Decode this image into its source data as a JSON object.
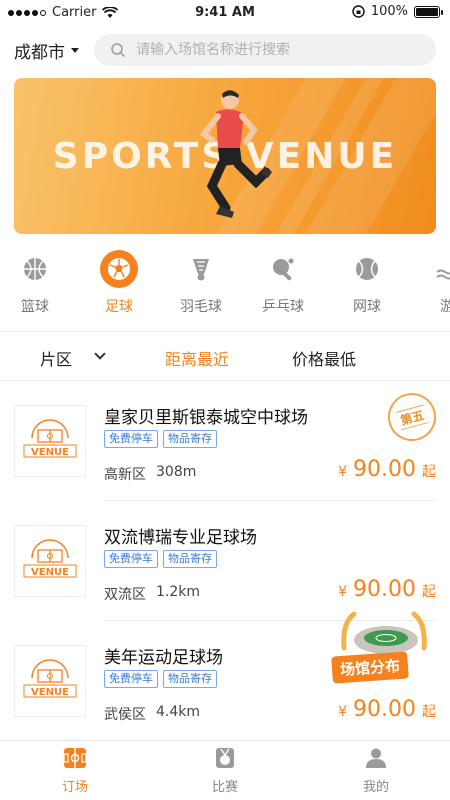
{
  "status_bar": {
    "carrier": "Carrier",
    "time": "9:41 AM",
    "battery": "100%"
  },
  "header": {
    "city": "成都市",
    "search_placeholder": "请输入场馆名称进行搜索"
  },
  "banner": {
    "title": "SPORTS VENUE"
  },
  "categories": [
    {
      "label": "篮球",
      "icon": "basketball-icon",
      "active": false
    },
    {
      "label": "足球",
      "icon": "soccer-ball-icon",
      "active": true
    },
    {
      "label": "羽毛球",
      "icon": "shuttlecock-icon",
      "active": false
    },
    {
      "label": "乒乓球",
      "icon": "ping-pong-icon",
      "active": false
    },
    {
      "label": "网球",
      "icon": "tennis-ball-icon",
      "active": false
    },
    {
      "label": "游",
      "icon": "swimming-icon",
      "active": false
    }
  ],
  "filters": {
    "area": "片区",
    "distance": "距离最近",
    "price": "价格最低"
  },
  "venues": [
    {
      "logo_text": "VENUE",
      "name": "皇家贝里斯银泰城空中球场",
      "tags": [
        "免费停车",
        "物品寄存"
      ],
      "district": "高新区",
      "distance": "308m",
      "currency": "¥",
      "price": "90.00",
      "price_suffix": "起",
      "badge": "第五"
    },
    {
      "logo_text": "VENUE",
      "name": "双流博瑞专业足球场",
      "tags": [
        "免费停车",
        "物品寄存"
      ],
      "district": "双流区",
      "distance": "1.2km",
      "currency": "¥",
      "price": "90.00",
      "price_suffix": "起"
    },
    {
      "logo_text": "VENUE",
      "name": "美年运动足球场",
      "tags": [
        "免费停车",
        "物品寄存"
      ],
      "district": "武侯区",
      "distance": "4.4km",
      "currency": "¥",
      "price": "90.00",
      "price_suffix": "起"
    }
  ],
  "promo": {
    "label": "场馆分布"
  },
  "tabbar": [
    {
      "label": "订场",
      "icon": "field-icon",
      "active": true
    },
    {
      "label": "比赛",
      "icon": "medal-icon",
      "active": false
    },
    {
      "label": "我的",
      "icon": "user-icon",
      "active": false
    }
  ],
  "colors": {
    "accent": "#f5821f",
    "tag_blue": "#3a7bd5"
  }
}
